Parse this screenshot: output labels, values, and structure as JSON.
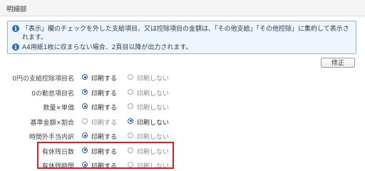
{
  "section": {
    "title": "明細部"
  },
  "info": {
    "line1": "「表示」欄のチェックを外した支給項目、又は控除項目の金額は、「その他支給」「その他控除」に集約して表示さ",
    "line2": "れます。",
    "line3": "A4用紙1枚に収まらない場合、2頁目以降が出力されます。",
    "icon_glyph": "i"
  },
  "edit_button": {
    "label": "修正"
  },
  "options": {
    "print": "印刷する",
    "no_print": "印刷しない"
  },
  "rows": [
    {
      "label": "0円の支給控除項目名",
      "selected": "print"
    },
    {
      "label": "0の勤怠項目名",
      "selected": "print"
    },
    {
      "label": "数量×単価",
      "selected": "print"
    },
    {
      "label": "基準金額×割合",
      "selected": "no_print"
    },
    {
      "label": "時間外手当内訳",
      "selected": "print"
    },
    {
      "label": "有休残日数",
      "selected": "print"
    },
    {
      "label": "有休残時間",
      "selected": "print"
    }
  ],
  "colors": {
    "accent": "#1d5fae",
    "highlight": "#e31b1b",
    "info_bg": "#eef5fc"
  }
}
